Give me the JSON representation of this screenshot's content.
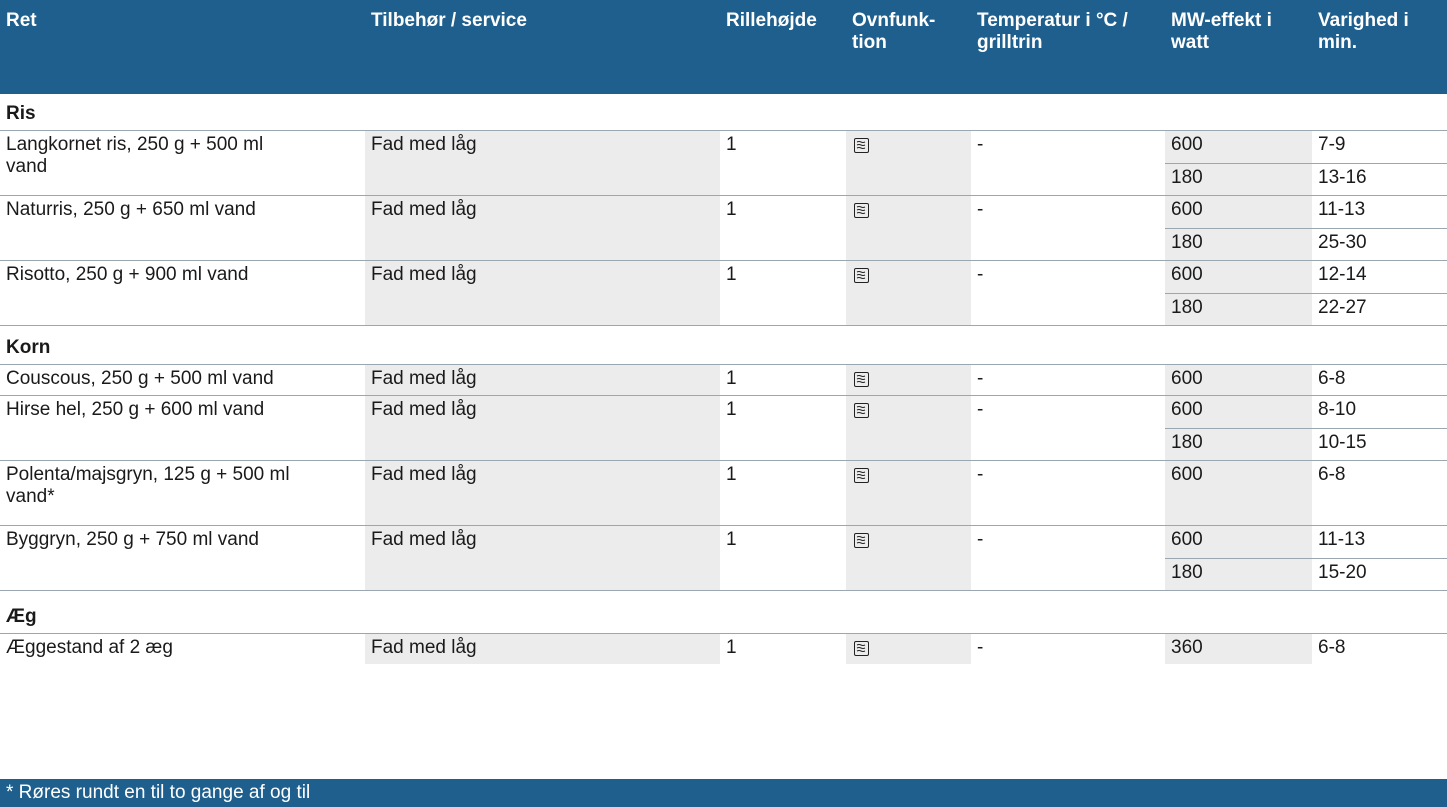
{
  "header": {
    "ret": "Ret",
    "tilbehoer": "Tilbehør / service",
    "rillehoejde": "Rillehøjde",
    "ovnfunktion_1": "Ovnfunk-",
    "ovnfunktion_2": "tion",
    "temperatur_1": "Temperatur i °C /",
    "temperatur_2": "grilltrin",
    "mw_1": "MW-effekt i",
    "mw_2": "watt",
    "varighed_1": "Varighed i",
    "varighed_2": "min."
  },
  "sections": {
    "ris": {
      "title": "Ris",
      "rows": [
        {
          "ret_1": "Langkornet ris, 250 g + 500 ml",
          "ret_2": "vand",
          "tilbehoer": "Fad med låg",
          "rille": "1",
          "temp": "-",
          "mw": [
            "600",
            "180"
          ],
          "tid": [
            "7-9",
            "13-16"
          ]
        },
        {
          "ret_1": "Naturris, 250 g + 650 ml vand",
          "tilbehoer": "Fad med låg",
          "rille": "1",
          "temp": "-",
          "mw": [
            "600",
            "180"
          ],
          "tid": [
            "11-13",
            "25-30"
          ]
        },
        {
          "ret_1": "Risotto, 250 g + 900 ml vand",
          "tilbehoer": "Fad med låg",
          "rille": "1",
          "temp": "-",
          "mw": [
            "600",
            "180"
          ],
          "tid": [
            "12-14",
            "22-27"
          ]
        }
      ]
    },
    "korn": {
      "title": "Korn",
      "rows": [
        {
          "ret_1": "Couscous, 250 g + 500 ml vand",
          "tilbehoer": "Fad med låg",
          "rille": "1",
          "temp": "-",
          "mw": [
            "600"
          ],
          "tid": [
            "6-8"
          ]
        },
        {
          "ret_1": "Hirse hel, 250 g + 600 ml vand",
          "tilbehoer": "Fad med låg",
          "rille": "1",
          "temp": "-",
          "mw": [
            "600",
            "180"
          ],
          "tid": [
            "8-10",
            "10-15"
          ]
        },
        {
          "ret_1": "Polenta/majsgryn, 125 g + 500 ml",
          "ret_2": "vand*",
          "tilbehoer": "Fad med låg",
          "rille": "1",
          "temp": "-",
          "mw": [
            "600"
          ],
          "tid": [
            "6-8"
          ]
        },
        {
          "ret_1": "Byggryn, 250 g + 750 ml vand",
          "tilbehoer": "Fad med låg",
          "rille": "1",
          "temp": "-",
          "mw": [
            "600",
            "180"
          ],
          "tid": [
            "11-13",
            "15-20"
          ]
        }
      ]
    },
    "aeg": {
      "title": "Æg",
      "rows": [
        {
          "ret_1": "Æggestand af 2 æg",
          "tilbehoer": "Fad med låg",
          "rille": "1",
          "temp": "-",
          "mw": [
            "360"
          ],
          "tid": [
            "6-8"
          ]
        }
      ]
    }
  },
  "icons": {
    "ovnfunktion": "microwave-waves-icon"
  },
  "colors": {
    "header_bg": "#1f5f8e",
    "shade": "#ececec"
  },
  "footer": {
    "note": "* Røres rundt en til to gange af og til"
  }
}
